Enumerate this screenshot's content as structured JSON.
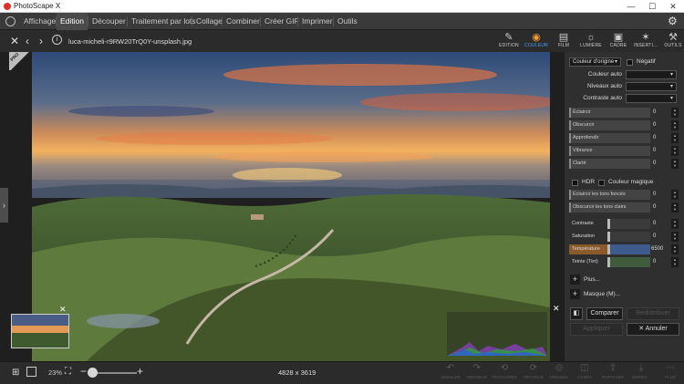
{
  "window": {
    "title": "PhotoScape X",
    "controls": {
      "minimize": "—",
      "maximize": "☐",
      "close": "✕"
    }
  },
  "menu": {
    "items": [
      "Affichage",
      "Edition",
      "Découper",
      "Traitement par lots",
      "Collage",
      "Combiner",
      "Créer GIF",
      "Imprimer",
      "Outils"
    ],
    "active_index": 1
  },
  "toolbar": {
    "filename": "luca-micheli-r9RW20TrQ0Y-unsplash.jpg",
    "icons": [
      "close-icon",
      "back-icon",
      "forward-icon",
      "info-icon"
    ]
  },
  "tabs": [
    {
      "label": "EDITION",
      "icon": "edit-icon"
    },
    {
      "label": "COULEUR",
      "icon": "color-icon",
      "active": true
    },
    {
      "label": "FILM",
      "icon": "film-icon"
    },
    {
      "label": "LUMIÈRE",
      "icon": "sun-icon"
    },
    {
      "label": "CADRE",
      "icon": "frame-icon"
    },
    {
      "label": "INSERTI...",
      "icon": "insert-icon"
    },
    {
      "label": "OUTILS",
      "icon": "tools-icon"
    }
  ],
  "canvas": {
    "badge": "PRO",
    "image_dimensions": "4828 x 3619",
    "zoom": "23%",
    "zoom_level_fraction": 0.1
  },
  "panel": {
    "mode_select": "Couleur d'origine",
    "negatif_label": "Négatif",
    "auto": [
      {
        "label": "Couleur auto",
        "value": ""
      },
      {
        "label": "Niveaux auto",
        "value": ""
      },
      {
        "label": "Contraste auto",
        "value": ""
      }
    ],
    "sliders": [
      {
        "label": "Éclaircir",
        "value": "0"
      },
      {
        "label": "Obscurcir",
        "value": "0"
      },
      {
        "label": "Approfondir",
        "value": "0"
      },
      {
        "label": "Vibrance",
        "value": "0"
      },
      {
        "label": "Clarté",
        "value": "0"
      }
    ],
    "hdr_label": "HDR",
    "magic_label": "Couleur magique",
    "tone_sliders": [
      {
        "label": "Éclaircir les tons foncés",
        "value": "0"
      },
      {
        "label": "Obscurcir les tons clairs",
        "value": "0"
      }
    ],
    "color_sliders": [
      {
        "label": "Contraste",
        "value": "0",
        "color": "#3b3b3b"
      },
      {
        "label": "Saturation",
        "value": "0",
        "color": "#3b3b3b"
      },
      {
        "label": "Température",
        "value": "6500",
        "color": "#3d5a8a"
      },
      {
        "label": "Teinte (Tint)",
        "value": "0",
        "color": "#3f5a3c"
      }
    ],
    "plus_label": "Plus...",
    "mask_label": "Masque (M)...",
    "compare_label": "Comparer",
    "apply_label": "Appliquer",
    "cancel_label": "Annuler",
    "redistribute_label": "Redistribuer"
  },
  "bottom_actions": [
    {
      "label": "ANNULER",
      "icon": "undo-icon"
    },
    {
      "label": "RÉTABLIR",
      "icon": "redo-icon"
    },
    {
      "label": "RESTAURER",
      "icon": "restore-icon"
    },
    {
      "label": "RÉTABLIR",
      "icon": "reset-icon"
    },
    {
      "label": "ORIGINAL",
      "icon": "original-icon"
    },
    {
      "label": "COMPA",
      "icon": "compare-icon"
    },
    {
      "label": "PARTAGER",
      "icon": "share-icon"
    },
    {
      "label": "ENREG...",
      "icon": "save-icon"
    },
    {
      "label": "PLUS",
      "icon": "more-icon"
    }
  ],
  "colors": {
    "accent": "#4aa3ff",
    "active_icon": "#f39c2e",
    "background": "#2b2b2b"
  }
}
